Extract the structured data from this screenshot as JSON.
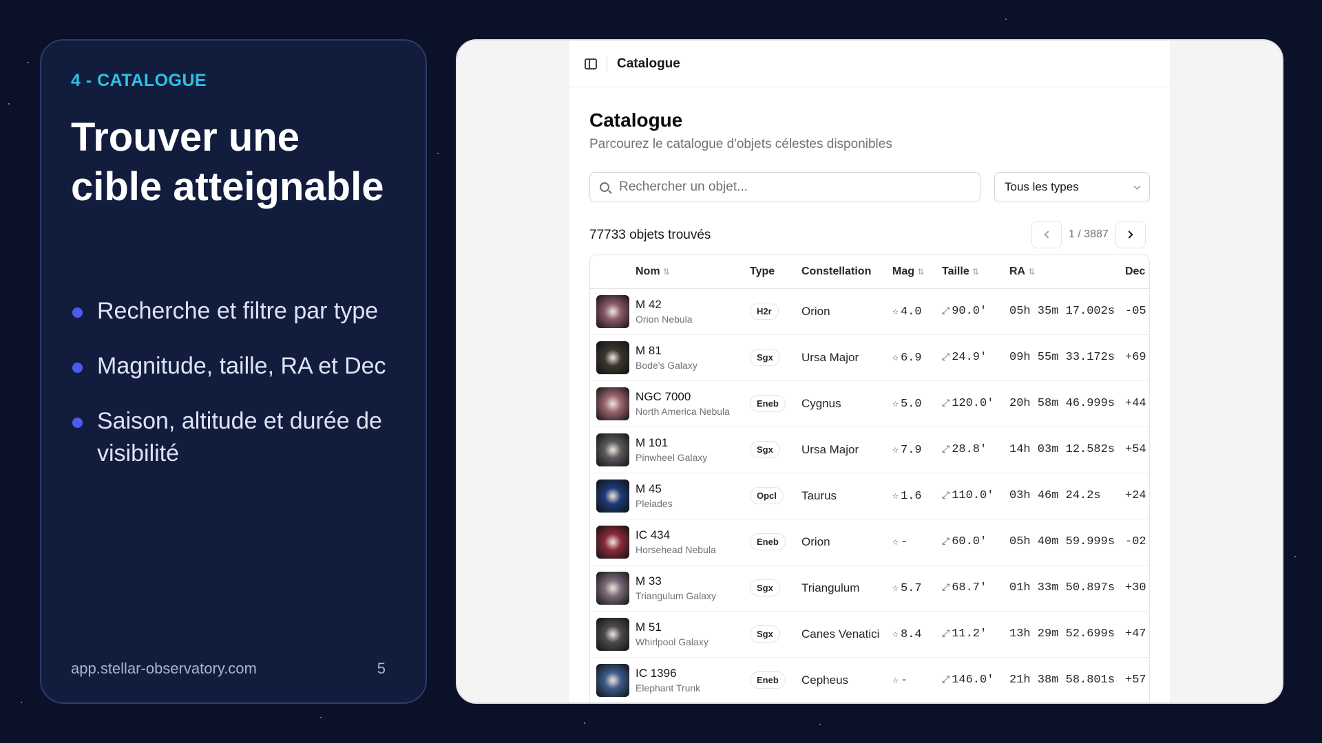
{
  "slide": {
    "section": "4 - CATALOGUE",
    "title": "Trouver une cible atteignable",
    "bullets": [
      "Recherche et filtre par type",
      "Magnitude, taille, RA et Dec",
      "Saison, altitude et durée de visibilité"
    ],
    "footer_url": "app.stellar-observatory.com",
    "page_number": "5"
  },
  "app": {
    "breadcrumb": "Catalogue",
    "page_title": "Catalogue",
    "page_subtitle": "Parcourez le catalogue d'objets célestes disponibles",
    "search_placeholder": "Rechercher un objet...",
    "type_filter": "Tous les types",
    "results_count": "77733 objets trouvés",
    "pagination": "1 / 3887",
    "columns": {
      "name": "Nom",
      "type": "Type",
      "constellation": "Constellation",
      "mag": "Mag",
      "size": "Taille",
      "ra": "RA",
      "dec": "Dec"
    },
    "rows": [
      {
        "name": "M 42",
        "common": "Orion Nebula",
        "type": "H2r",
        "constellation": "Orion",
        "mag": "4.0",
        "size": "90.0'",
        "ra": "05h 35m 17.002s",
        "dec": "-05",
        "thumb_color": "#8a5a6a"
      },
      {
        "name": "M 81",
        "common": "Bode's Galaxy",
        "type": "Sgx",
        "constellation": "Ursa Major",
        "mag": "6.9",
        "size": "24.9'",
        "ra": "09h 55m 33.172s",
        "dec": "+69",
        "thumb_color": "#3b3630"
      },
      {
        "name": "NGC 7000",
        "common": "North America Nebula",
        "type": "Eneb",
        "constellation": "Cygnus",
        "mag": "5.0",
        "size": "120.0'",
        "ra": "20h 58m 46.999s",
        "dec": "+44",
        "thumb_color": "#9b6670"
      },
      {
        "name": "M 101",
        "common": "Pinwheel Galaxy",
        "type": "Sgx",
        "constellation": "Ursa Major",
        "mag": "7.9",
        "size": "28.8'",
        "ra": "14h 03m 12.582s",
        "dec": "+54",
        "thumb_color": "#5c5a5c"
      },
      {
        "name": "M 45",
        "common": "Pleiades",
        "type": "Opcl",
        "constellation": "Taurus",
        "mag": "1.6",
        "size": "110.0'",
        "ra": "03h 46m 24.2s",
        "dec": "+24",
        "thumb_color": "#1e3a78"
      },
      {
        "name": "IC 434",
        "common": "Horsehead Nebula",
        "type": "Eneb",
        "constellation": "Orion",
        "mag": "-",
        "size": "60.0'",
        "ra": "05h 40m 59.999s",
        "dec": "-02",
        "thumb_color": "#8a2a3a"
      },
      {
        "name": "M 33",
        "common": "Triangulum Galaxy",
        "type": "Sgx",
        "constellation": "Triangulum",
        "mag": "5.7",
        "size": "68.7'",
        "ra": "01h 33m 50.897s",
        "dec": "+30",
        "thumb_color": "#7a6b78"
      },
      {
        "name": "M 51",
        "common": "Whirlpool Galaxy",
        "type": "Sgx",
        "constellation": "Canes Venatici",
        "mag": "8.4",
        "size": "11.2'",
        "ra": "13h 29m 52.699s",
        "dec": "+47",
        "thumb_color": "#4c4c4e"
      },
      {
        "name": "IC 1396",
        "common": "Elephant Trunk",
        "type": "Eneb",
        "constellation": "Cepheus",
        "mag": "-",
        "size": "146.0'",
        "ra": "21h 38m 58.801s",
        "dec": "+57",
        "thumb_color": "#3d5a8a"
      }
    ]
  }
}
